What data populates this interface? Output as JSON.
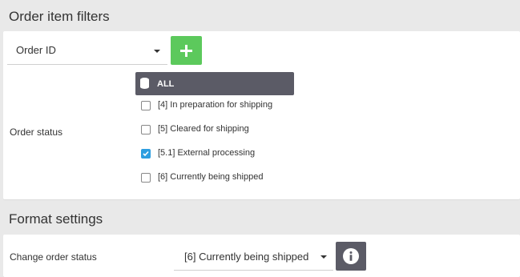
{
  "filters": {
    "title": "Order item filters",
    "field_select": {
      "value": "Order ID"
    },
    "add_icon": "plus-icon",
    "order_status": {
      "label": "Order status",
      "all_label": "ALL",
      "options": [
        {
          "label": "[4] In preparation for shipping",
          "checked": false
        },
        {
          "label": "[5] Cleared for shipping",
          "checked": false
        },
        {
          "label": "[5.1] External processing",
          "checked": true
        },
        {
          "label": "[6] Currently being shipped",
          "checked": false
        }
      ]
    }
  },
  "format": {
    "title": "Format settings",
    "change_status": {
      "label": "Change order status",
      "value": "[6] Currently being shipped"
    },
    "info_icon": "info-icon"
  },
  "colors": {
    "add_button": "#5cc95c",
    "dark_button": "#5b5b66",
    "checkbox_checked": "#2d9ee0"
  }
}
